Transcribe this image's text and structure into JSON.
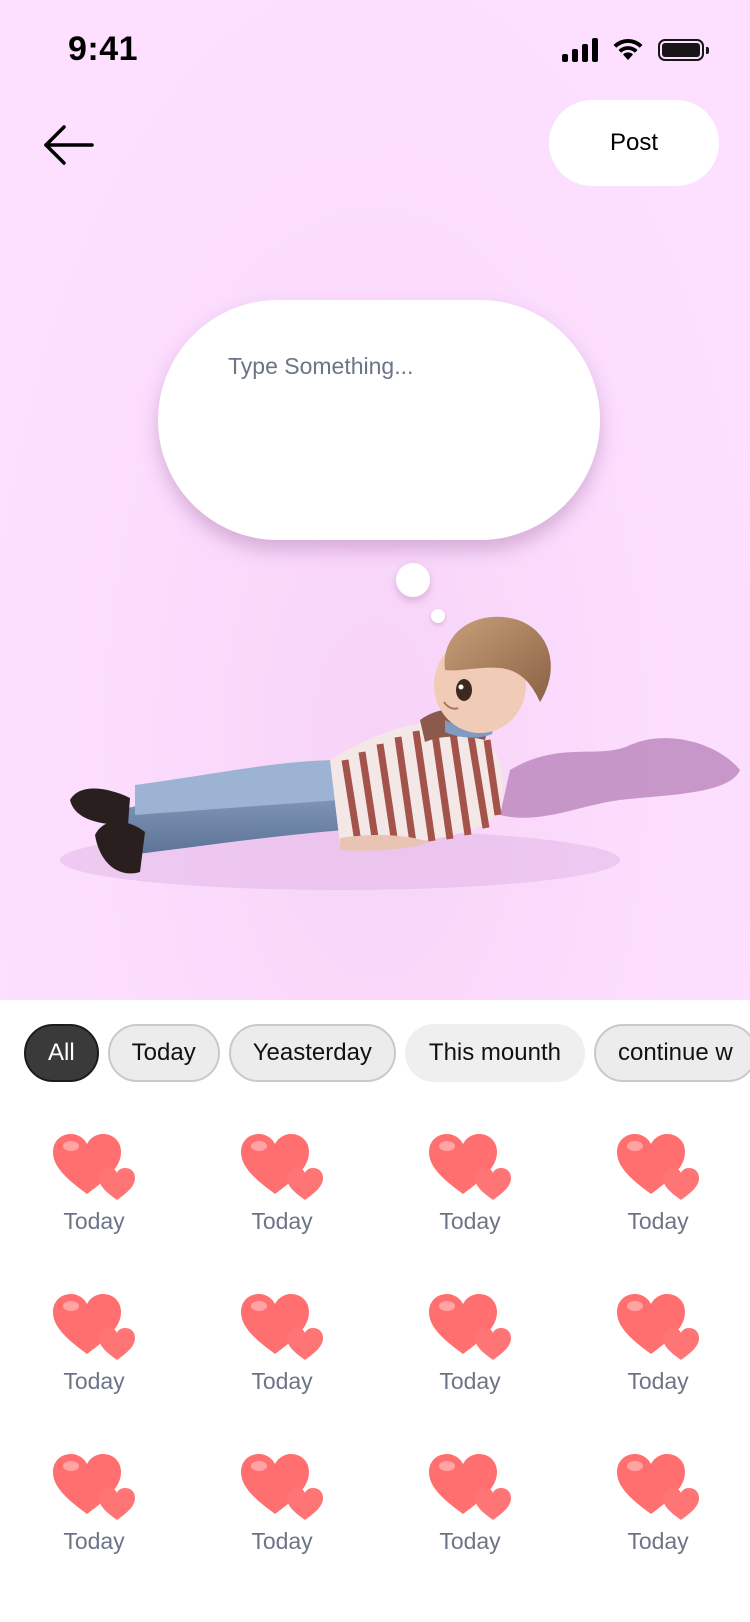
{
  "status_bar": {
    "time": "9:41"
  },
  "header": {
    "post_label": "Post"
  },
  "thought_bubble": {
    "placeholder": "Type Something..."
  },
  "filters": [
    {
      "label": "All",
      "active": true
    },
    {
      "label": "Today",
      "active": false
    },
    {
      "label": "Yeasterday",
      "active": false
    },
    {
      "label": "This mounth",
      "active": false
    },
    {
      "label": "continue w",
      "active": false
    }
  ],
  "grid": {
    "icon": "heart-icon",
    "items": [
      {
        "label": "Today"
      },
      {
        "label": "Today"
      },
      {
        "label": "Today"
      },
      {
        "label": "Today"
      },
      {
        "label": "Today"
      },
      {
        "label": "Today"
      },
      {
        "label": "Today"
      },
      {
        "label": "Today"
      },
      {
        "label": "Today"
      },
      {
        "label": "Today"
      },
      {
        "label": "Today"
      },
      {
        "label": "Today"
      }
    ]
  },
  "colors": {
    "hero_background": "#fde0ff",
    "chip_active": "#3a3a3a",
    "chip_inactive": "#ececec",
    "heart": "#ff6f6f",
    "label_gray": "#6c7587"
  }
}
